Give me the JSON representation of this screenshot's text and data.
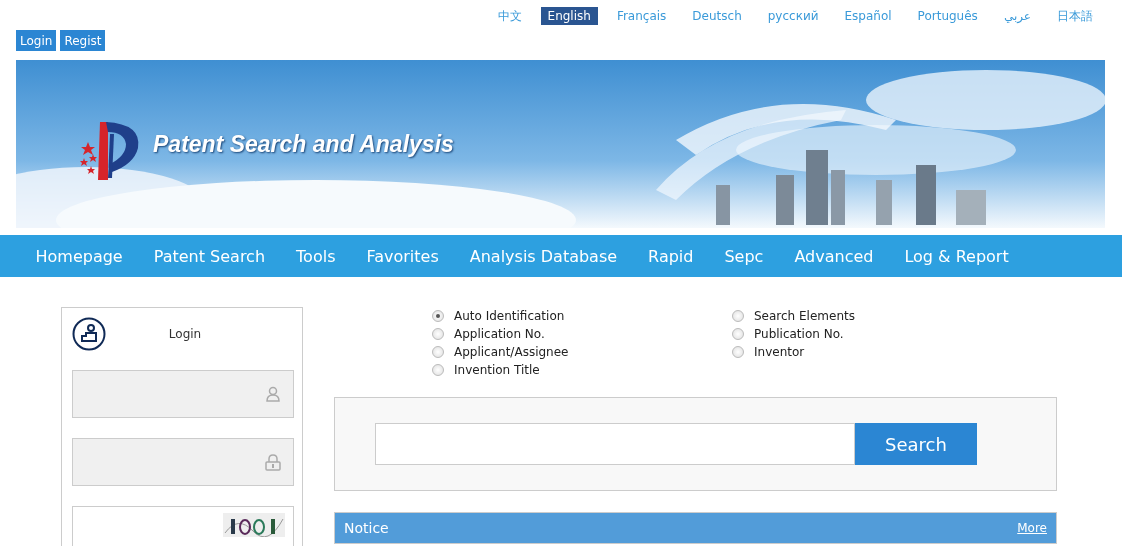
{
  "languages": [
    {
      "label": "中文",
      "selected": false
    },
    {
      "label": "English",
      "selected": true
    },
    {
      "label": "Français",
      "selected": false
    },
    {
      "label": "Deutsch",
      "selected": false
    },
    {
      "label": "русский",
      "selected": false
    },
    {
      "label": "Español",
      "selected": false
    },
    {
      "label": "Português",
      "selected": false
    },
    {
      "label": "عربي",
      "selected": false
    },
    {
      "label": "日本語",
      "selected": false
    }
  ],
  "account_buttons": [
    "Login",
    "Regist"
  ],
  "banner": {
    "title": "Patent Search and Analysis"
  },
  "nav": [
    "Homepage",
    "Patent Search",
    "Tools",
    "Favorites",
    "Analysis Database",
    "Rapid",
    "Sepc",
    "Advanced",
    "Log & Report"
  ],
  "login_panel": {
    "title": "Login"
  },
  "search_type_columns": [
    [
      {
        "label": "Auto Identification",
        "selected": true
      },
      {
        "label": "Application No.",
        "selected": false
      },
      {
        "label": "Applicant/Assignee",
        "selected": false
      },
      {
        "label": "Invention Title",
        "selected": false
      }
    ],
    [
      {
        "label": "Search Elements",
        "selected": false
      },
      {
        "label": "Publication No.",
        "selected": false
      },
      {
        "label": "Inventor",
        "selected": false
      }
    ]
  ],
  "search": {
    "button": "Search"
  },
  "notice": {
    "title": "Notice",
    "more": "More"
  }
}
